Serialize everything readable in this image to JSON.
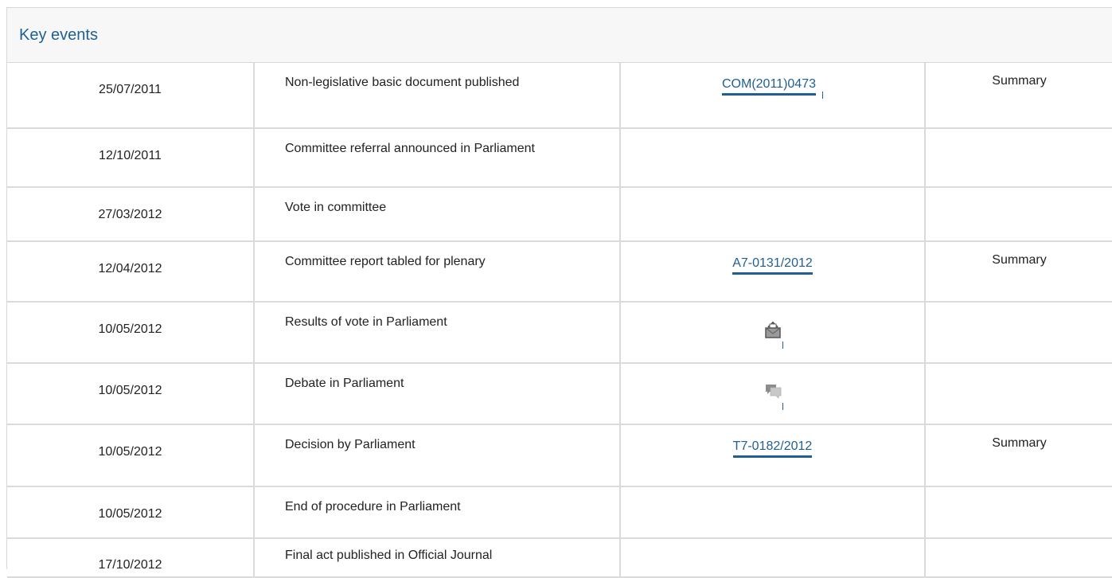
{
  "panel": {
    "title": "Key events"
  },
  "columns": [
    "date",
    "event",
    "document",
    "summary"
  ],
  "rows": [
    {
      "date": "25/07/2011",
      "event": "Non-legislative basic document published",
      "doc_link": "COM(2011)0473",
      "summary": "Summary"
    },
    {
      "date": "12/10/2011",
      "event": "Committee referral announced in Parliament",
      "doc_link": "",
      "summary": ""
    },
    {
      "date": "27/03/2012",
      "event": "Vote in committee",
      "doc_link": "",
      "summary": ""
    },
    {
      "date": "12/04/2012",
      "event": "Committee report tabled for plenary",
      "doc_link": "A7-0131/2012",
      "summary": "Summary"
    },
    {
      "date": "10/05/2012",
      "event": "Results of vote in Parliament",
      "doc_icon": "ballot-box-icon",
      "summary": ""
    },
    {
      "date": "10/05/2012",
      "event": "Debate in Parliament",
      "doc_icon": "speech-bubbles-icon",
      "summary": ""
    },
    {
      "date": "10/05/2012",
      "event": "Decision by Parliament",
      "doc_link": "T7-0182/2012",
      "summary": "Summary"
    },
    {
      "date": "10/05/2012",
      "event": "End of procedure in Parliament",
      "doc_link": "",
      "summary": ""
    },
    {
      "date": "17/10/2012",
      "event": "Final act published in Official Journal",
      "doc_link": "",
      "summary": ""
    }
  ],
  "colors": {
    "accent": "#1f5f93",
    "border": "#dadada",
    "header_bg": "#f7f7f7",
    "icon_gray": "#9a9a9a"
  }
}
